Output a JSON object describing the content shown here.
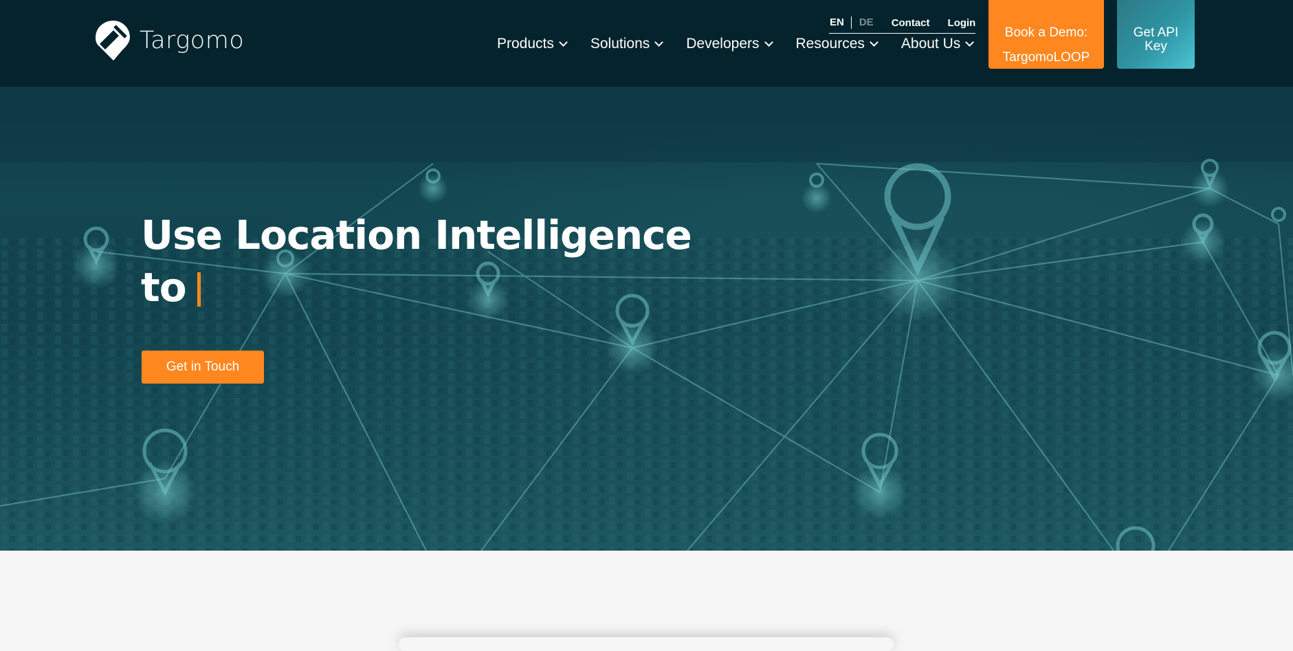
{
  "brand": {
    "name": "Targomo",
    "logo_icon": "targomo-logo-icon"
  },
  "topbar": {
    "lang_en": "EN",
    "lang_de": "DE",
    "contact": "Contact",
    "login": "Login"
  },
  "nav": {
    "items": [
      {
        "label": "Products"
      },
      {
        "label": "Solutions"
      },
      {
        "label": "Developers"
      },
      {
        "label": "Resources"
      },
      {
        "label": "About Us"
      }
    ]
  },
  "cta": {
    "demo_line1": "Book a Demo:",
    "demo_line2": "TargomoLOOP",
    "api_label": "Get API Key"
  },
  "hero": {
    "title_line1": "Use Location Intelligence",
    "title_line2": "to",
    "button_label": "Get in Touch"
  },
  "colors": {
    "header_bg": "#04232c",
    "accent_orange": "#ff871f",
    "accent_teal": "#2f95a4",
    "hero_overlay": "#134954"
  }
}
